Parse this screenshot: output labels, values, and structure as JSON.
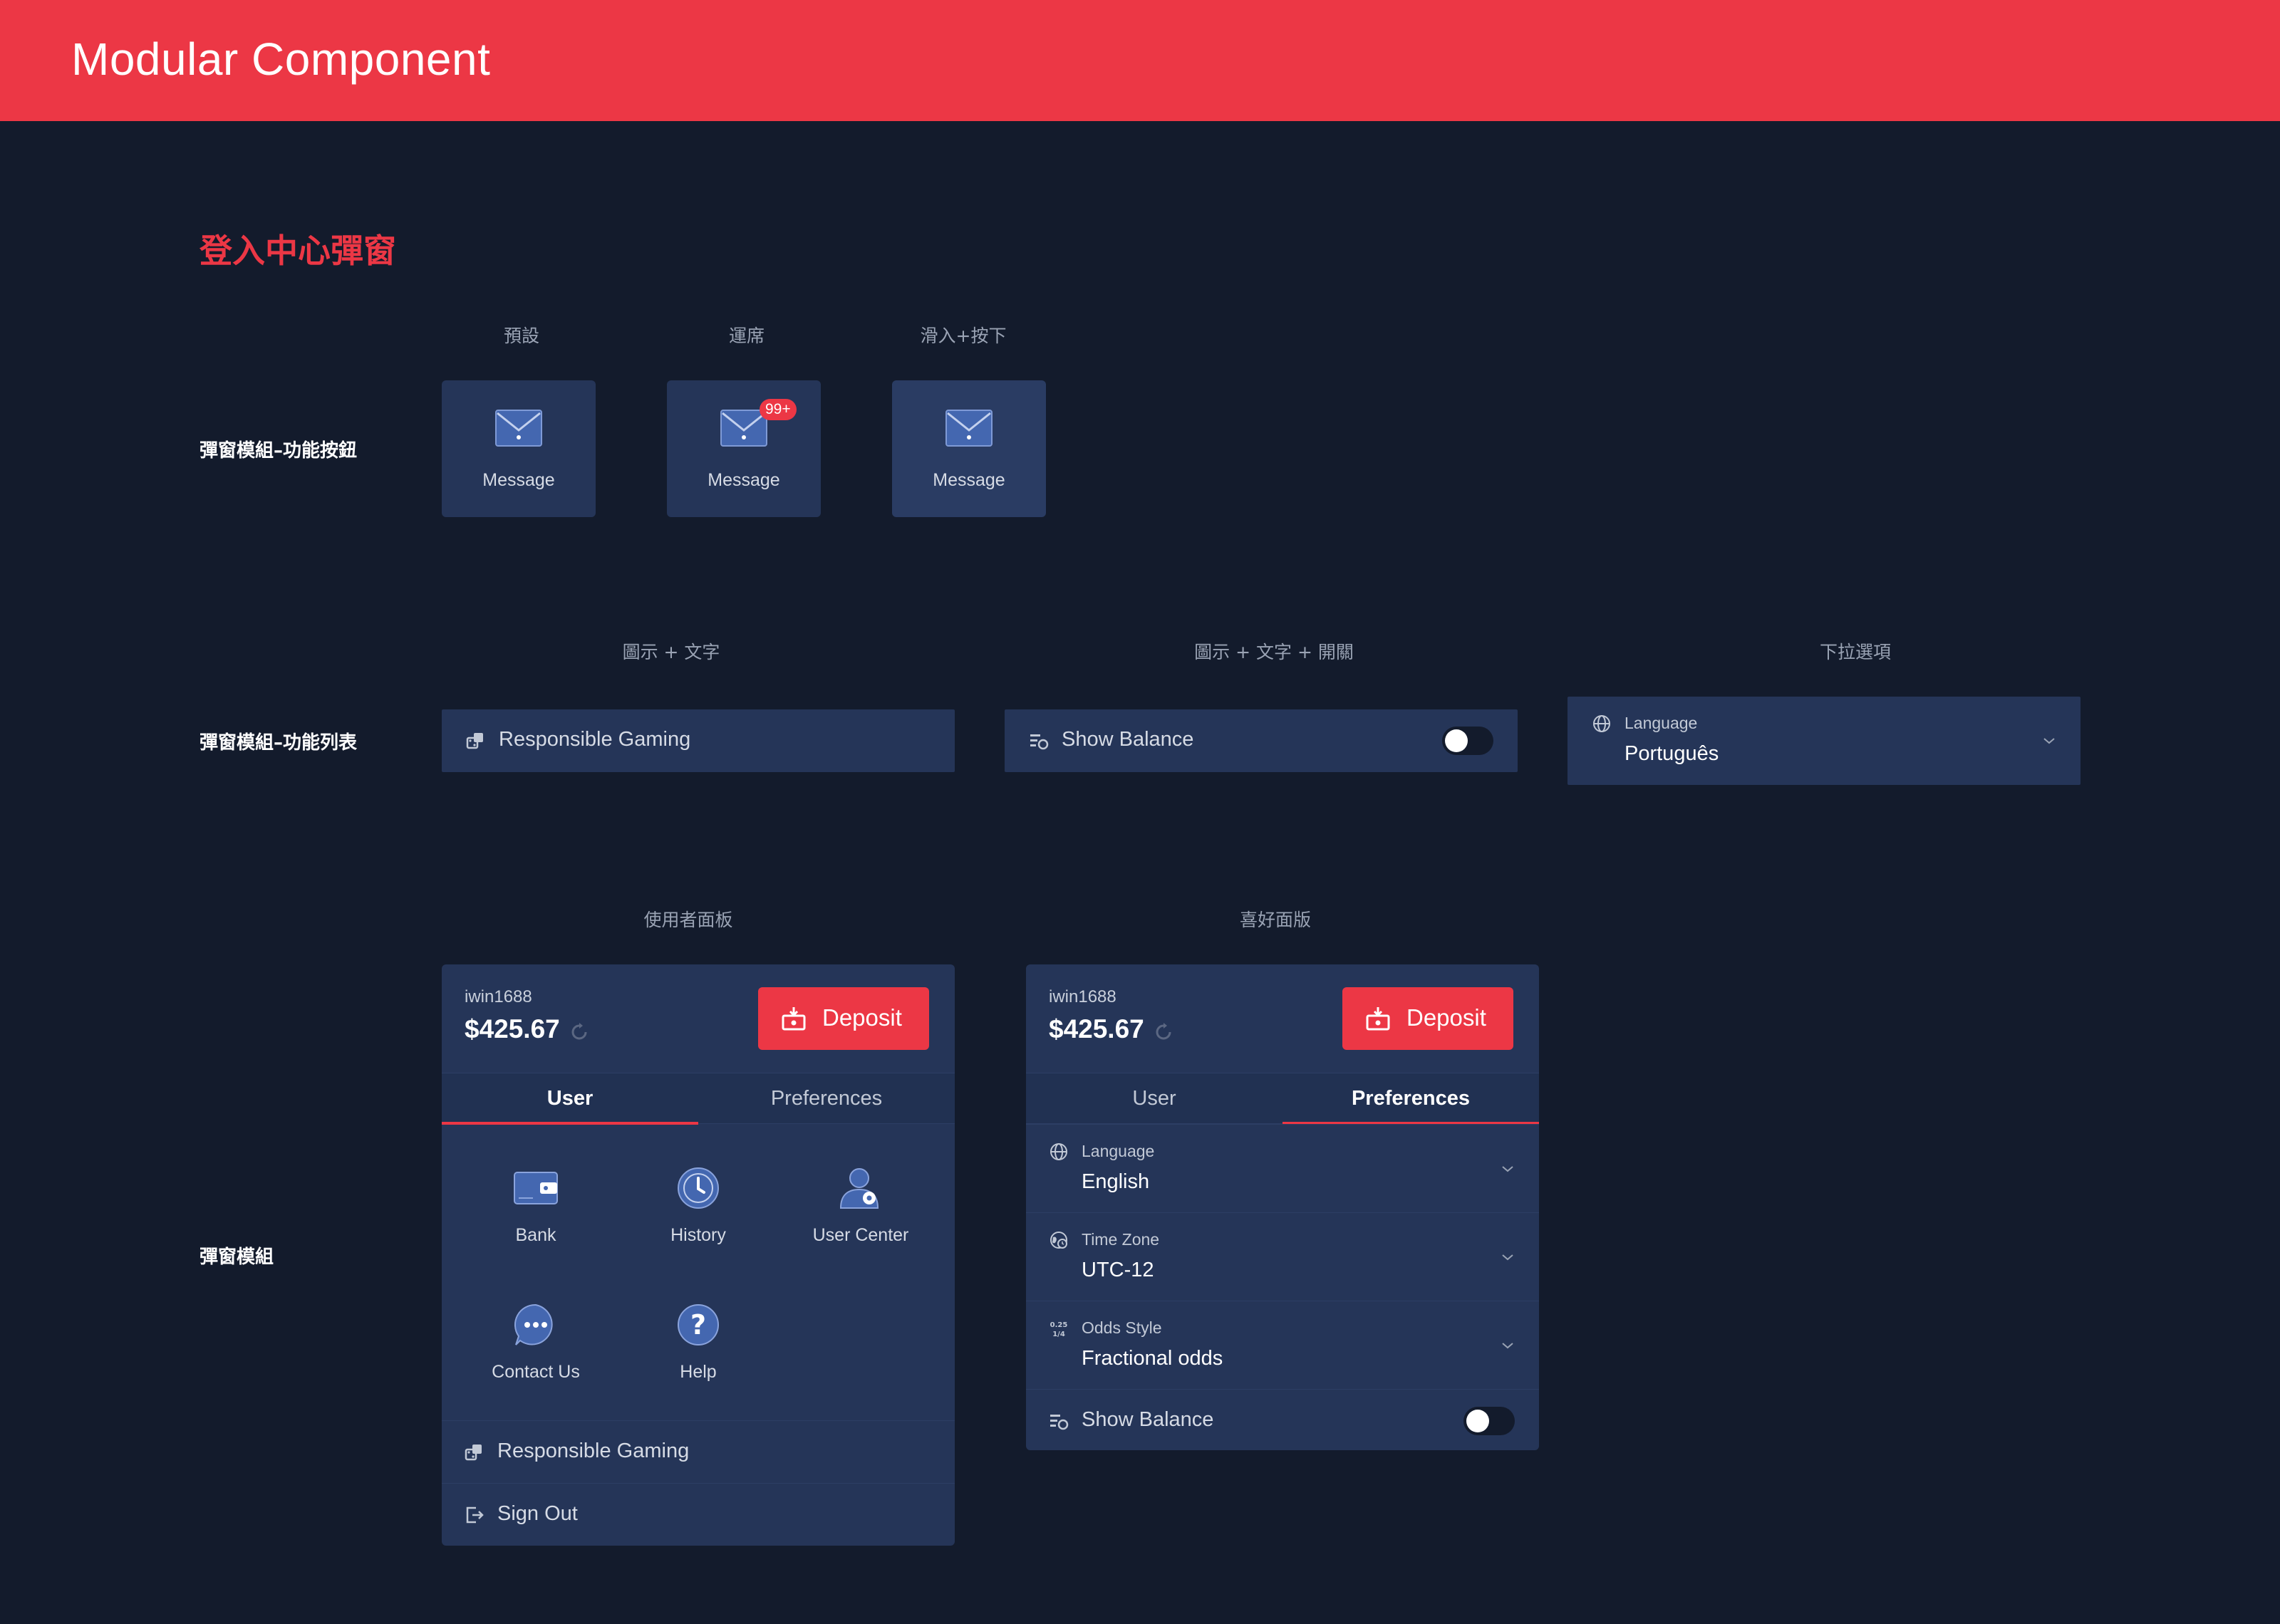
{
  "header": {
    "title": "Modular Component"
  },
  "section": {
    "title": "登入中心彈窗"
  },
  "rows": {
    "buttons": "彈窗模組–功能按鈕",
    "list": "彈窗模組–功能列表",
    "module": "彈窗模組"
  },
  "states": {
    "default": "預設",
    "present": "運席",
    "hover": "滑入+按下"
  },
  "message_tiles": [
    {
      "label": "Message"
    },
    {
      "label": "Message",
      "badge": "99+"
    },
    {
      "label": "Message"
    }
  ],
  "list_cols": {
    "icon_text": "圖示 + 文字",
    "icon_text_toggle": "圖示 + 文字 + 開關",
    "dropdown": "下拉選項"
  },
  "list_items": {
    "responsible": "Responsible Gaming",
    "show_balance": "Show Balance",
    "show_balance_on": false
  },
  "dropdown": {
    "label": "Language",
    "value": "Português"
  },
  "panel_cols": {
    "user": "使用者面板",
    "prefs": "喜好面版"
  },
  "account": {
    "username": "iwin1688",
    "balance": "$425.67",
    "deposit": "Deposit"
  },
  "tabs": {
    "user": "User",
    "preferences": "Preferences"
  },
  "user_menu": [
    {
      "label": "Bank",
      "icon": "wallet-icon"
    },
    {
      "label": "History",
      "icon": "clock-icon"
    },
    {
      "label": "User Center",
      "icon": "user-gear-icon"
    },
    {
      "label": "Contact Us",
      "icon": "chat-bubble-icon"
    },
    {
      "label": "Help",
      "icon": "question-icon"
    }
  ],
  "user_rows": {
    "responsible": "Responsible Gaming",
    "sign_out": "Sign Out"
  },
  "preferences": [
    {
      "label": "Language",
      "value": "English",
      "icon": "globe-icon"
    },
    {
      "label": "Time Zone",
      "value": "UTC-12",
      "icon": "clock-globe-icon"
    },
    {
      "label": "Odds Style",
      "value": "Fractional odds",
      "icon": "odds-icon"
    }
  ],
  "pref_show_balance": "Show Balance",
  "odds_icon_text": {
    "top": "0.25",
    "bottom": "1/4"
  },
  "colors": {
    "accent": "#ec3745",
    "background": "#131b2c",
    "card": "#253558"
  }
}
